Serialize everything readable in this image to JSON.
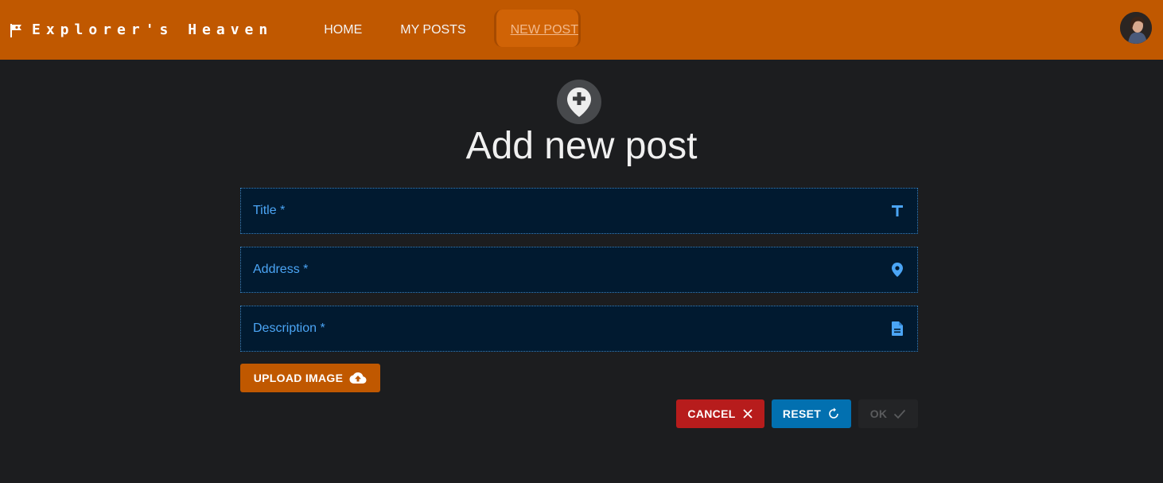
{
  "header": {
    "brand": "Explorer's Heaven",
    "brand_icon": "flag-icon",
    "nav": [
      {
        "label": "HOME"
      },
      {
        "label": "MY POSTS"
      },
      {
        "label": "NEW POST",
        "active": true
      }
    ],
    "avatar_icon": "user-avatar"
  },
  "main": {
    "hero_icon": "map-marker-plus-icon",
    "title": "Add new post",
    "fields": [
      {
        "label": "Title *",
        "icon": "format-title-icon"
      },
      {
        "label": "Address *",
        "icon": "map-marker-icon"
      },
      {
        "label": "Description *",
        "icon": "file-document-icon"
      }
    ],
    "upload_label": "UPLOAD IMAGE",
    "actions": {
      "cancel": "CANCEL",
      "reset": "RESET",
      "ok": "OK"
    }
  },
  "colors": {
    "header_bg": "#c05800",
    "page_bg": "#1c1d1f",
    "field_bg": "#011a30",
    "field_accent": "#4ba5f5",
    "cancel": "#b71c1c",
    "reset": "#0270b0"
  }
}
